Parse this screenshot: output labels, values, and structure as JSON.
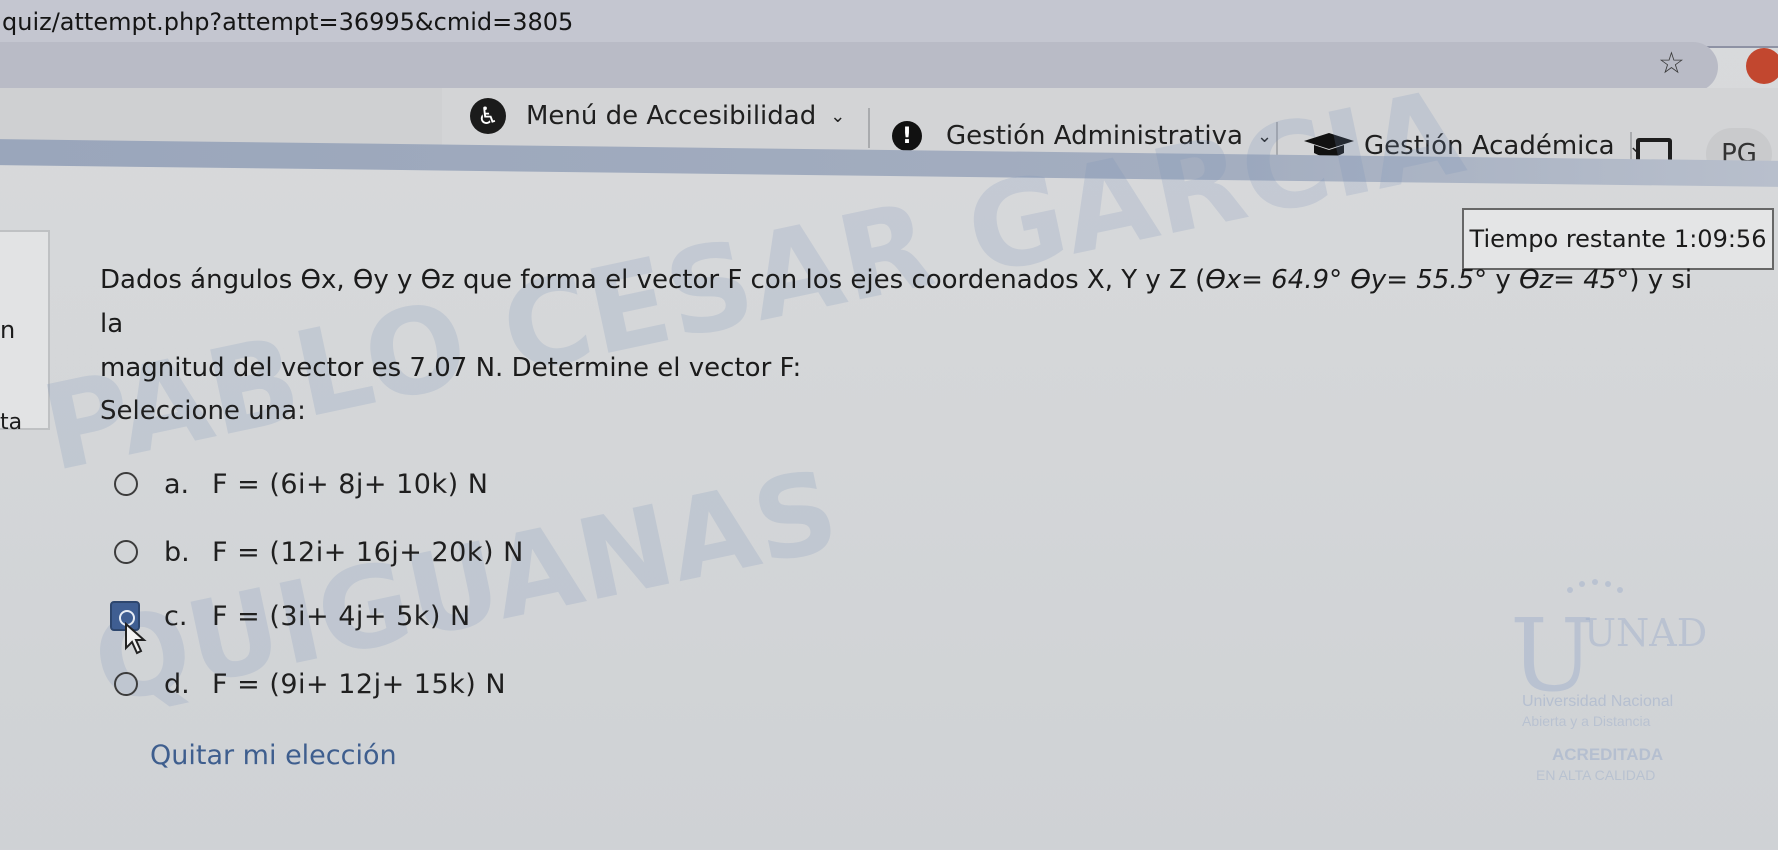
{
  "browser": {
    "url": "quiz/attempt.php?attempt=36995&cmid=3805"
  },
  "nav": {
    "accessibility_label": "Menú de Accesibilidad",
    "admin_label": "Gestión Administrativa",
    "academic_label": "Gestión Académica",
    "avatar_initials": "PG"
  },
  "sidebar": {
    "partial_n": "n",
    "partial_ta": "ta"
  },
  "timer": {
    "label": "Tiempo restante",
    "value": "1:09:56"
  },
  "question": {
    "line1_text": "Dados ángulos ϴx, ϴy y ϴz que forma el vector F con los ejes coordenados X, Y y Z (",
    "theta_x": "ϴx= 64.9°",
    "theta_y": "ϴy= 55.5°",
    "joiner": " y ",
    "theta_z": "ϴz= 45°",
    "line1_end": ") y si la",
    "line2_text": "magnitud del vector es 7.07 N. Determine el vector F:"
  },
  "answers": {
    "select_label": "Seleccione una:",
    "options": [
      {
        "letter": "a.",
        "text": "F = (6i+ 8j+ 10k) N"
      },
      {
        "letter": "b.",
        "text": "F = (12i+ 16j+ 20k) N"
      },
      {
        "letter": "c.",
        "text": "F = (3i+ 4j+ 5k) N"
      },
      {
        "letter": "d.",
        "text": "F = (9i+ 12j+ 15k) N"
      }
    ],
    "clear_label": "Quitar mi elección"
  },
  "watermark": {
    "line1": "PABLO CESAR GARCIA",
    "line2": "QUIGUANAS"
  },
  "logo": {
    "name": "UNAD",
    "line1": "Universidad Nacional",
    "line2": "Abierta y a Distancia",
    "line3": "ACREDITADA",
    "line4": "EN ALTA CALIDAD"
  },
  "colors": {
    "link": "#3e5e8e",
    "focus": "#3f5e92"
  }
}
